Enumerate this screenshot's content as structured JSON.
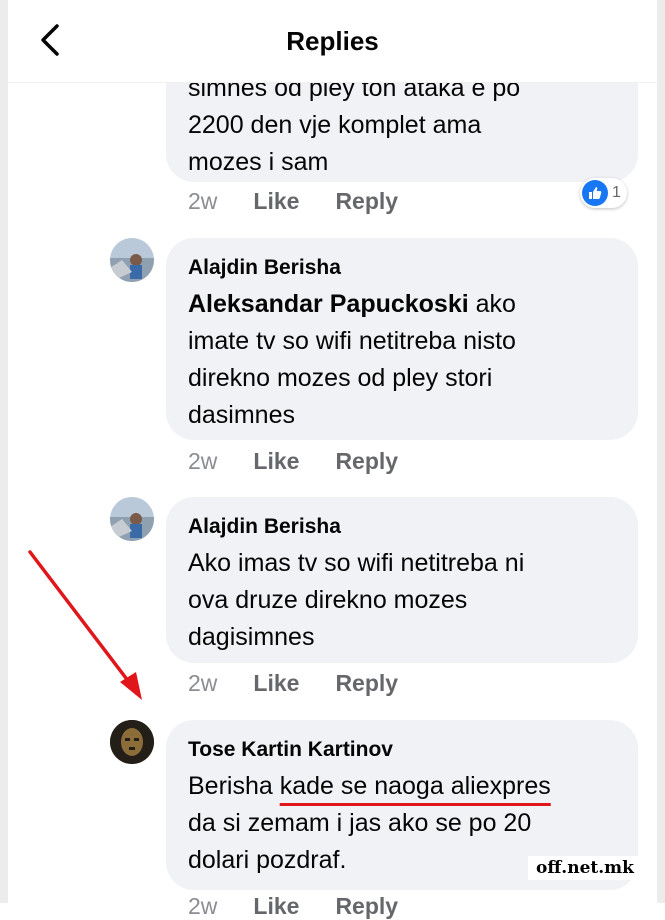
{
  "header": {
    "title": "Replies"
  },
  "replies": [
    {
      "author": "",
      "cut_text": "simnes od pley ton ataka e po",
      "lines": [
        "2200 den vje komplet ama",
        "mozes i sam"
      ],
      "time": "2w",
      "like": "Like",
      "reply": "Reply",
      "reaction_count": "1"
    },
    {
      "author": "Alajdin Berisha",
      "mention": "Aleksandar Papuckoski",
      "after_mention": " ako",
      "lines": [
        "imate tv so wifi netitreba nisto",
        "direkno mozes od pley stori",
        "dasimnes"
      ],
      "time": "2w",
      "like": "Like",
      "reply": "Reply"
    },
    {
      "author": "Alajdin Berisha",
      "lines": [
        "Ako imas tv so wifi netitreba ni",
        "ova druze direkno mozes",
        "dagisimnes"
      ],
      "time": "2w",
      "like": "Like",
      "reply": "Reply"
    },
    {
      "author": "Tose Kartin Kartinov",
      "first_plain": "Berisha ",
      "first_underlined": "kade se naoga aliexpres",
      "lines": [
        "da si zemam i jas ako se po 20",
        "dolari pozdraf."
      ],
      "time": "2w",
      "like": "Like",
      "reply": "Reply"
    }
  ],
  "watermark": "off.net.mk",
  "colors": {
    "bubble": "#f0f2f5",
    "like_blue": "#1877f2",
    "annotation_red": "#e0161b",
    "meta_gray": "#65676b"
  },
  "icons": [
    "back-arrow-icon",
    "like-reaction-icon",
    "annotation-arrow-icon"
  ]
}
